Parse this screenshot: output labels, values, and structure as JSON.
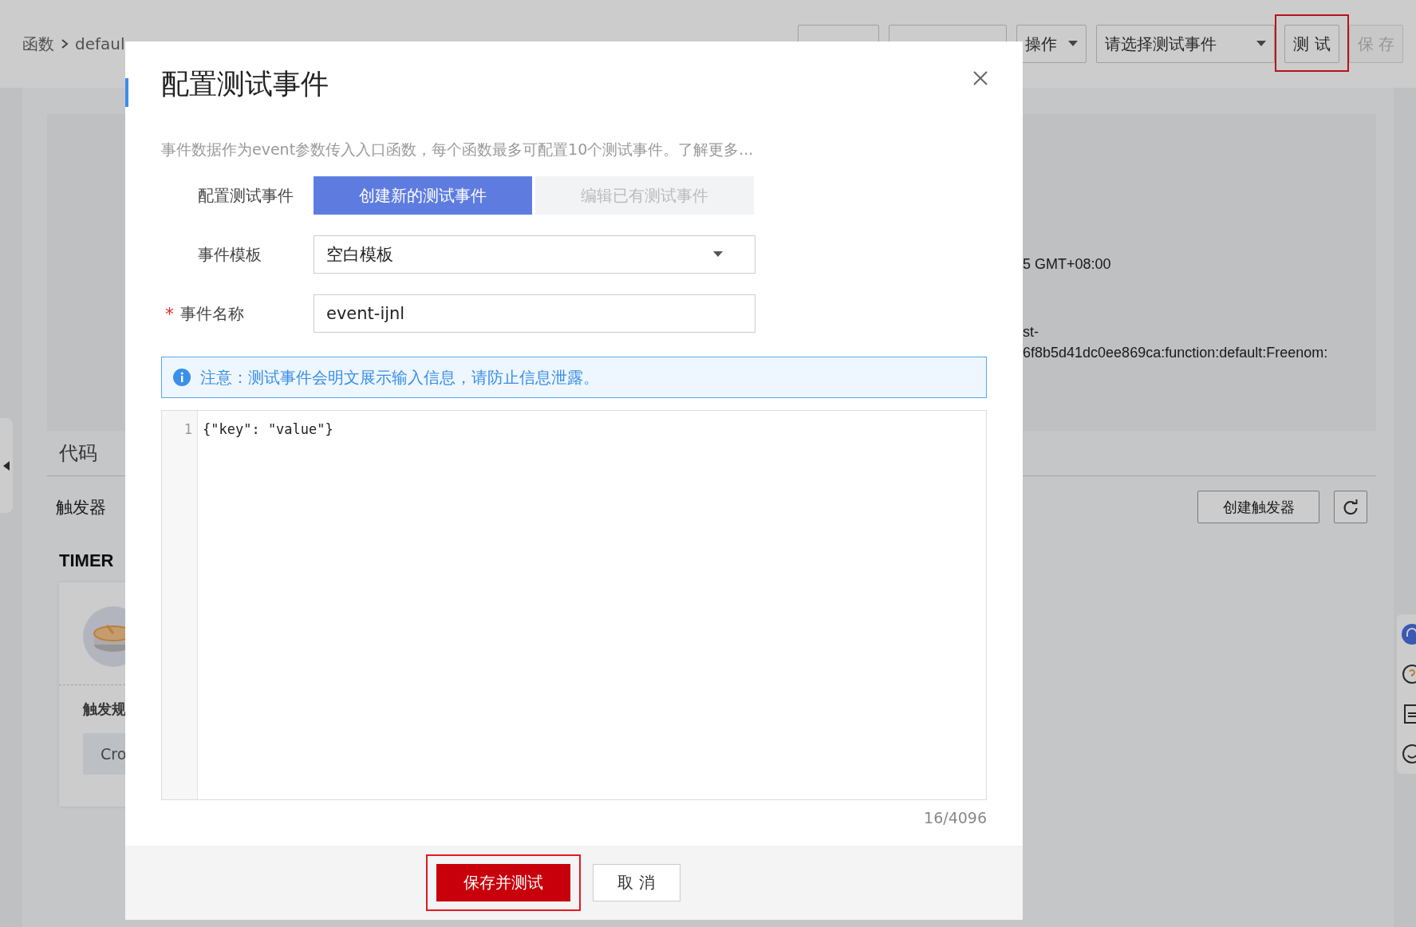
{
  "page": {
    "breadcrumb": [
      {
        "label": "函数"
      },
      {
        "label": "defaul"
      }
    ],
    "toolbar": [
      {
        "kind": "blank",
        "disabled": false,
        "highlighted": false
      },
      {
        "kind": "blank",
        "disabled": false,
        "highlighted": false
      },
      {
        "kind": "dropdown",
        "label": "操作",
        "disabled": false,
        "highlighted": false
      },
      {
        "kind": "select",
        "label": "请选择测试事件",
        "disabled": false,
        "highlighted": false
      },
      {
        "kind": "button",
        "label": "测 试",
        "disabled": false,
        "highlighted": true
      },
      {
        "kind": "button",
        "label": "保 存",
        "disabled": true,
        "highlighted": false
      }
    ],
    "info_lines": [
      "5 GMT+08:00",
      "st-",
      "6f8b5d41dc0ee869ca:function:default:Freenom:"
    ],
    "code_tab": "代码",
    "triggers_label": "触发器",
    "create_trigger_button": "创建触发器",
    "timer_title": "TIMER",
    "trigger_card": {
      "rule_label": "触发规",
      "tag": "Cro"
    }
  },
  "dialog": {
    "title": "配置测试事件",
    "description": "事件数据作为event参数传入入口函数，每个函数最多可配置10个测试事件。了解更多...",
    "mode": {
      "label": "配置测试事件",
      "options": [
        {
          "label": "创建新的测试事件",
          "selected": true
        },
        {
          "label": "编辑已有测试事件",
          "selected": false
        }
      ]
    },
    "template": {
      "label": "事件模板",
      "value": "空白模板"
    },
    "event_name": {
      "label": "事件名称",
      "required": true,
      "required_mark": "*",
      "value": "event-ijnl"
    },
    "notice": "注意：测试事件会明文展示输入信息，请防止信息泄露。",
    "editor": {
      "lines": [
        {
          "number": "1",
          "code": "{\"key\": \"value\"}"
        }
      ]
    },
    "counter": "16/4096",
    "buttons": [
      {
        "kind": "primary",
        "label": "保存并测试",
        "highlighted": true
      },
      {
        "kind": "default",
        "label": "取 消",
        "highlighted": false
      }
    ]
  }
}
